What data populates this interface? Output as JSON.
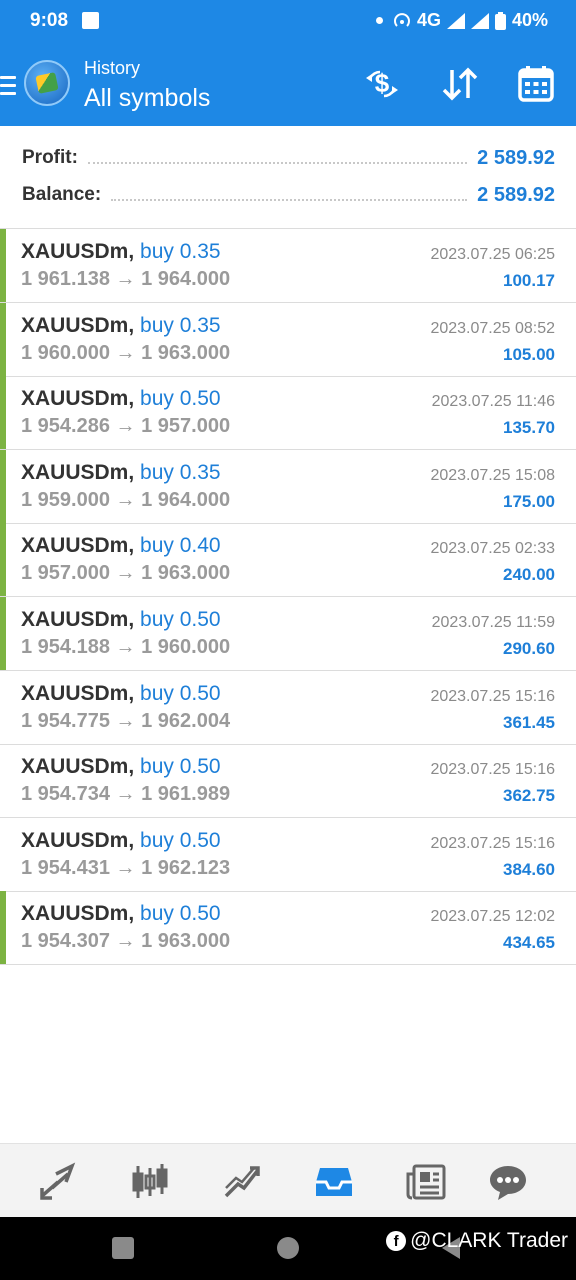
{
  "status_bar": {
    "time": "9:08",
    "network": "4G",
    "battery": "40%"
  },
  "header": {
    "subtitle": "History",
    "title": "All symbols"
  },
  "summary": {
    "profit_label": "Profit:",
    "profit_value": "2 589.92",
    "balance_label": "Balance:",
    "balance_value": "2 589.92"
  },
  "deals": [
    {
      "symbol": "XAUUSDm,",
      "direction": "buy 0.35",
      "open": "1 961.138",
      "close": "1 964.000",
      "time": "2023.07.25 06:25",
      "profit": "100.17",
      "marker": true
    },
    {
      "symbol": "XAUUSDm,",
      "direction": "buy 0.35",
      "open": "1 960.000",
      "close": "1 963.000",
      "time": "2023.07.25 08:52",
      "profit": "105.00",
      "marker": true
    },
    {
      "symbol": "XAUUSDm,",
      "direction": "buy 0.50",
      "open": "1 954.286",
      "close": "1 957.000",
      "time": "2023.07.25 11:46",
      "profit": "135.70",
      "marker": true
    },
    {
      "symbol": "XAUUSDm,",
      "direction": "buy 0.35",
      "open": "1 959.000",
      "close": "1 964.000",
      "time": "2023.07.25 15:08",
      "profit": "175.00",
      "marker": true
    },
    {
      "symbol": "XAUUSDm,",
      "direction": "buy 0.40",
      "open": "1 957.000",
      "close": "1 963.000",
      "time": "2023.07.25 02:33",
      "profit": "240.00",
      "marker": true
    },
    {
      "symbol": "XAUUSDm,",
      "direction": "buy 0.50",
      "open": "1 954.188",
      "close": "1 960.000",
      "time": "2023.07.25 11:59",
      "profit": "290.60",
      "marker": true
    },
    {
      "symbol": "XAUUSDm,",
      "direction": "buy 0.50",
      "open": "1 954.775",
      "close": "1 962.004",
      "time": "2023.07.25 15:16",
      "profit": "361.45",
      "marker": false
    },
    {
      "symbol": "XAUUSDm,",
      "direction": "buy 0.50",
      "open": "1 954.734",
      "close": "1 961.989",
      "time": "2023.07.25 15:16",
      "profit": "362.75",
      "marker": false
    },
    {
      "symbol": "XAUUSDm,",
      "direction": "buy 0.50",
      "open": "1 954.431",
      "close": "1 962.123",
      "time": "2023.07.25 15:16",
      "profit": "384.60",
      "marker": false
    },
    {
      "symbol": "XAUUSDm,",
      "direction": "buy 0.50",
      "open": "1 954.307",
      "close": "1 963.000",
      "time": "2023.07.25 12:02",
      "profit": "434.65",
      "marker": true
    }
  ],
  "arrow": "→",
  "toolbar_icons": [
    "deposit-icon",
    "sort-icon",
    "calendar-icon"
  ],
  "bottom_nav": [
    "trade-icon",
    "chart-icon",
    "quotes-icon",
    "history-icon",
    "news-icon",
    "chat-icon"
  ],
  "watermark": "@CLARK Trader",
  "colors": {
    "accent": "#1e88e5",
    "buy": "#1e7fd8",
    "win_marker": "#7cb342"
  }
}
